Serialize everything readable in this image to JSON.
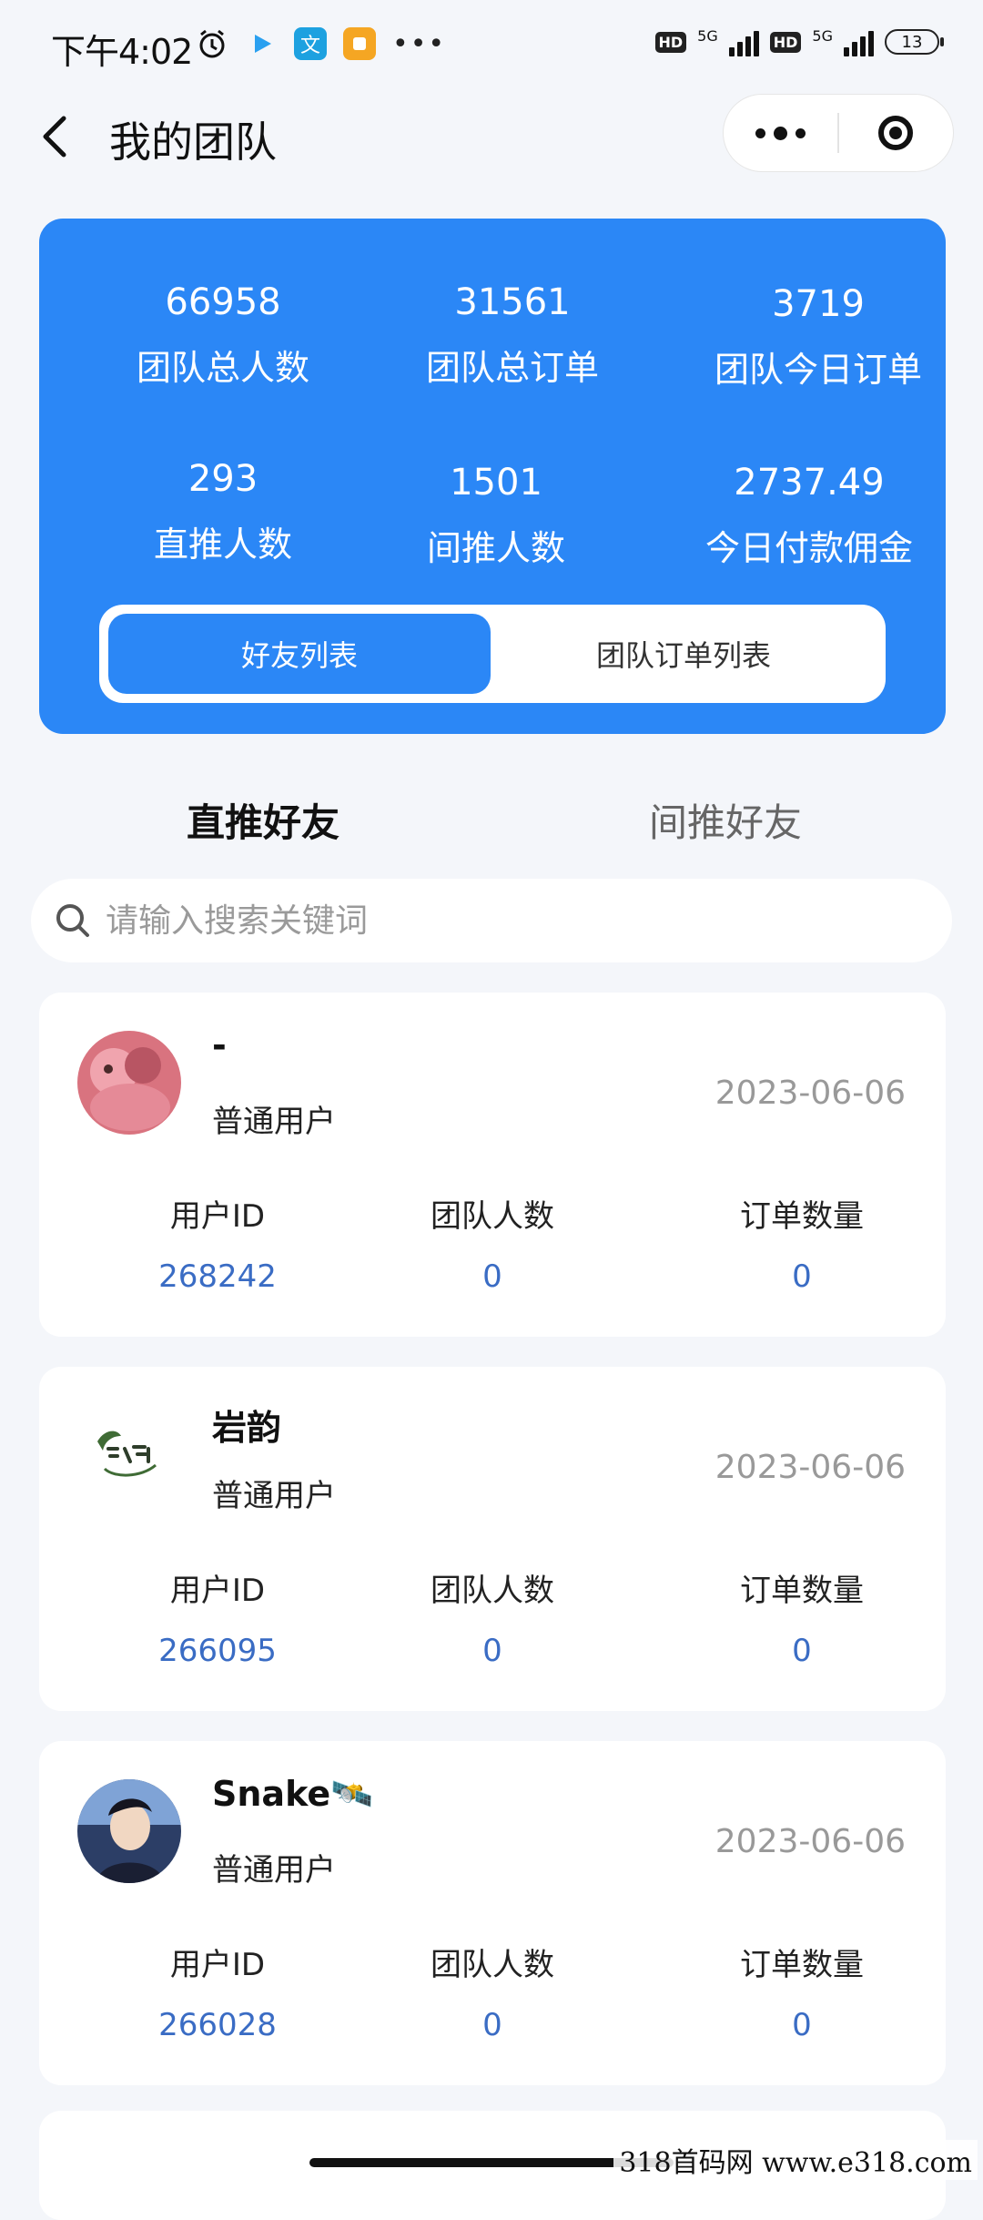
{
  "status_bar": {
    "time": "下午4:02",
    "network_left": "5G",
    "network_right": "5G",
    "hd_left": "HD",
    "hd_right": "HD",
    "battery": "13"
  },
  "nav": {
    "title": "我的团队"
  },
  "stats": {
    "team_total_members": {
      "value": "66958",
      "label": "团队总人数"
    },
    "team_total_orders": {
      "value": "31561",
      "label": "团队总订单"
    },
    "team_today_orders": {
      "value": "3719",
      "label": "团队今日订单"
    },
    "direct_referrals": {
      "value": "293",
      "label": "直推人数"
    },
    "indirect_referrals": {
      "value": "1501",
      "label": "间推人数"
    },
    "today_commission": {
      "value": "2737.49",
      "label": "今日付款佣金"
    }
  },
  "toggle": {
    "friends_list": "好友列表",
    "team_orders_list": "团队订单列表"
  },
  "tabs": {
    "direct_friends": "直推好友",
    "indirect_friends": "间推好友"
  },
  "search": {
    "placeholder": "请输入搜索关键词"
  },
  "friends": [
    {
      "name": "-",
      "role": "普通用户",
      "date": "2023-06-06",
      "id_label": "用户ID",
      "id": "268242",
      "team_label": "团队人数",
      "team": "0",
      "orders_label": "订单数量",
      "orders": "0"
    },
    {
      "name": "岩韵",
      "role": "普通用户",
      "date": "2023-06-06",
      "id_label": "用户ID",
      "id": "266095",
      "team_label": "团队人数",
      "team": "0",
      "orders_label": "订单数量",
      "orders": "0"
    },
    {
      "name": "Snake🛰️",
      "role": "普通用户",
      "date": "2023-06-06",
      "id_label": "用户ID",
      "id": "266028",
      "team_label": "团队人数",
      "team": "0",
      "orders_label": "订单数量",
      "orders": "0"
    }
  ],
  "watermark": "318首码网  www.e318.com",
  "colors": {
    "primary": "#2b87f6",
    "id_value": "#3a6cc4",
    "background": "#f4f6fa"
  }
}
